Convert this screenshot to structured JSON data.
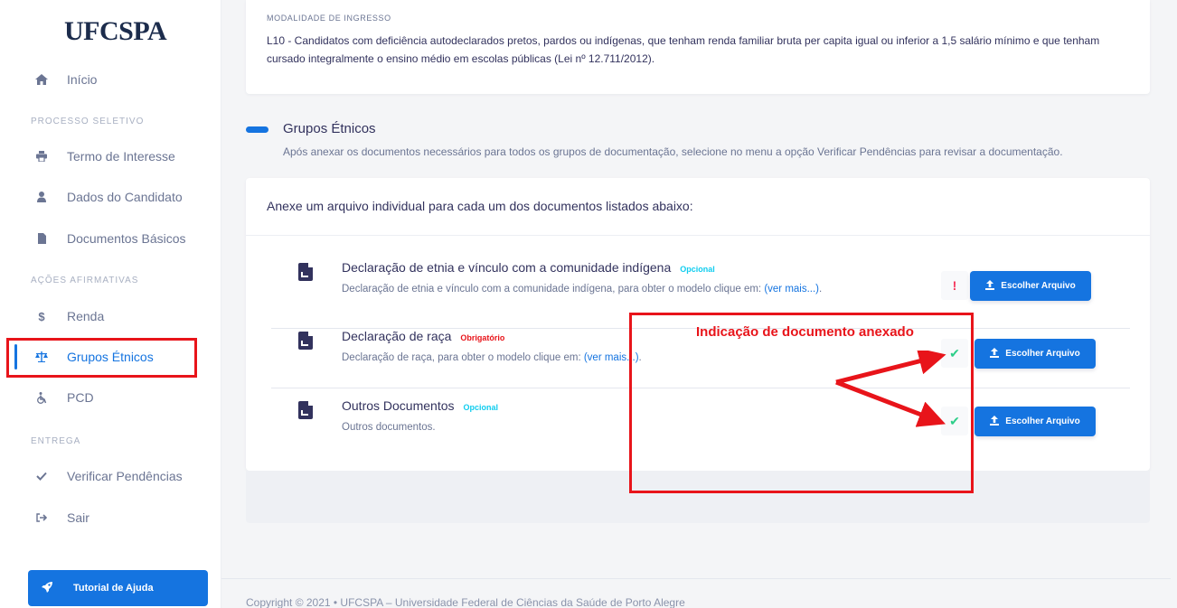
{
  "sidebar": {
    "logo": "UFCSPA",
    "home": {
      "icon": "home-icon",
      "label": "Início"
    },
    "section_processo": "PROCESSO SELETIVO",
    "termo": {
      "icon": "print-icon",
      "label": "Termo de Interesse"
    },
    "dados": {
      "icon": "user-icon",
      "label": "Dados do Candidato"
    },
    "documentos": {
      "icon": "file-icon",
      "label": "Documentos Básicos"
    },
    "section_acoes": "AÇÕES AFIRMATIVAS",
    "renda": {
      "icon": "dollar-icon",
      "label": "Renda"
    },
    "grupos": {
      "icon": "balance-scale-icon",
      "label": "Grupos Étnicos"
    },
    "pcd": {
      "icon": "wheelchair-icon",
      "label": "PCD"
    },
    "section_entrega": "ENTREGA",
    "verificar": {
      "icon": "check-icon",
      "label": "Verificar Pendências"
    },
    "sair": {
      "icon": "sign-out-icon",
      "label": "Sair"
    },
    "help_button": {
      "icon": "rocket-icon",
      "label": "Tutorial de Ajuda"
    },
    "accent_color": "#1574e0"
  },
  "modalidade": {
    "label": "MODALIDADE DE INGRESSO",
    "text": "L10 - Candidatos com deficiência autodeclarados pretos, pardos ou indígenas, que tenham renda familiar bruta per capita igual ou inferior a 1,5 salário mínimo e que tenham cursado integralmente o ensino médio em escolas públicas (Lei nº 12.711/2012)."
  },
  "section": {
    "title": "Grupos Étnicos",
    "description": "Após anexar os documentos necessários para todos os grupos de documentação, selecione no menu a opção Verificar Pendências para revisar a documentação."
  },
  "card": {
    "heading": "Anexe um arquivo individual para cada um dos documentos listados abaixo:",
    "documents": [
      {
        "title": "Declaração de etnia e vínculo com a comunidade indígena",
        "badge": "Opcional",
        "desc": "Declaração de etnia e vínculo com a comunidade indígena, para obter o modelo clique em: ",
        "link": "(ver mais...)",
        "desc_end": ".",
        "status": "!",
        "button": "Escolher Arquivo"
      },
      {
        "title": "Declaração de raça",
        "badge": "Obrigatório",
        "desc": "Declaração de raça, para obter o modelo clique em: ",
        "link": "(ver mais...)",
        "desc_end": ".",
        "status": "✔",
        "button": "Escolher Arquivo"
      },
      {
        "title": "Outros Documentos",
        "badge": "Opcional",
        "desc": "Outros documentos.",
        "link": "",
        "desc_end": "",
        "status": "✔",
        "button": "Escolher Arquivo"
      }
    ]
  },
  "annotation": {
    "text": "Indicação de documento anexado",
    "color": "#e8141a"
  },
  "footer": {
    "text": "Copyright © 2021  •  UFCSPA – Universidade Federal de Ciências da Saúde de Porto Alegre"
  }
}
